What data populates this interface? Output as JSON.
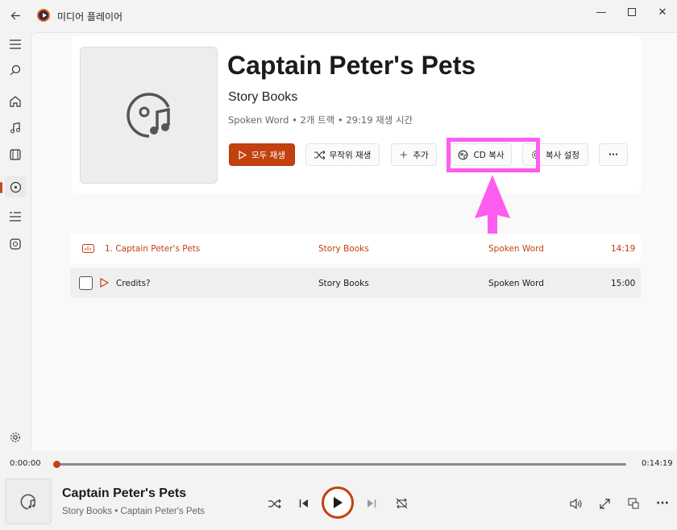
{
  "app": {
    "title": "미디어 플레이어"
  },
  "album": {
    "title": "Captain Peter's Pets",
    "artist": "Story Books",
    "meta": "Spoken Word • 2개 트랙 • 29:19 재생 시간"
  },
  "actions": {
    "play_all": "모두 재생",
    "shuffle": "무작위 재생",
    "add": "추가",
    "rip_cd": "CD 복사",
    "rip_settings": "복사 설정",
    "more": "···"
  },
  "tracks": [
    {
      "number_title": "1.  Captain Peter's Pets",
      "artist": "Story Books",
      "genre": "Spoken Word",
      "duration": "14:19"
    },
    {
      "number_title": "Credits?",
      "artist": "Story Books",
      "genre": "Spoken Word",
      "duration": "15:00"
    }
  ],
  "player": {
    "elapsed": "0:00:00",
    "total": "0:14:19",
    "progress": 0.0,
    "now_title": "Captain Peter's Pets",
    "now_sub": "Story Books • Captain Peter's Pets"
  },
  "colors": {
    "accent": "#c2410f",
    "highlight": "#ff5cf0"
  }
}
